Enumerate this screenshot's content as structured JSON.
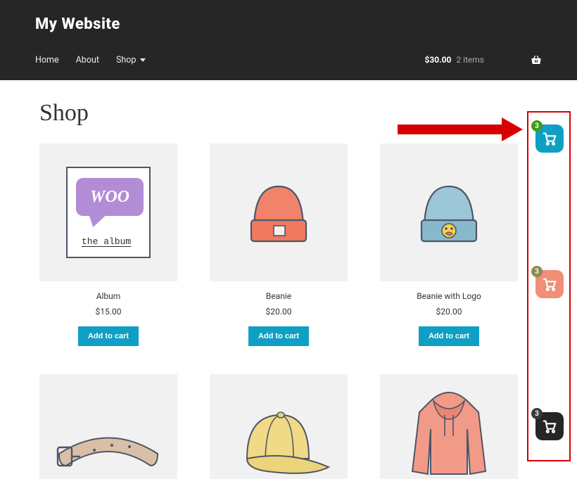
{
  "site_title": "My Website",
  "nav": {
    "home": "Home",
    "about": "About",
    "shop": "Shop"
  },
  "cart": {
    "total": "$30.00",
    "items_text": "2 items"
  },
  "page_title": "Shop",
  "add_label": "Add to cart",
  "products": [
    {
      "name": "Album",
      "price": "$15.00"
    },
    {
      "name": "Beanie",
      "price": "$20.00"
    },
    {
      "name": "Beanie with Logo",
      "price": "$20.00"
    }
  ],
  "float_badges": {
    "a": "3",
    "b": "3",
    "c": "3"
  },
  "woo": {
    "logo": "WOO",
    "sub": " the  album "
  },
  "colors": {
    "accent": "#0f9fc4",
    "header_bg": "#262626",
    "highlight": "#d70000"
  }
}
